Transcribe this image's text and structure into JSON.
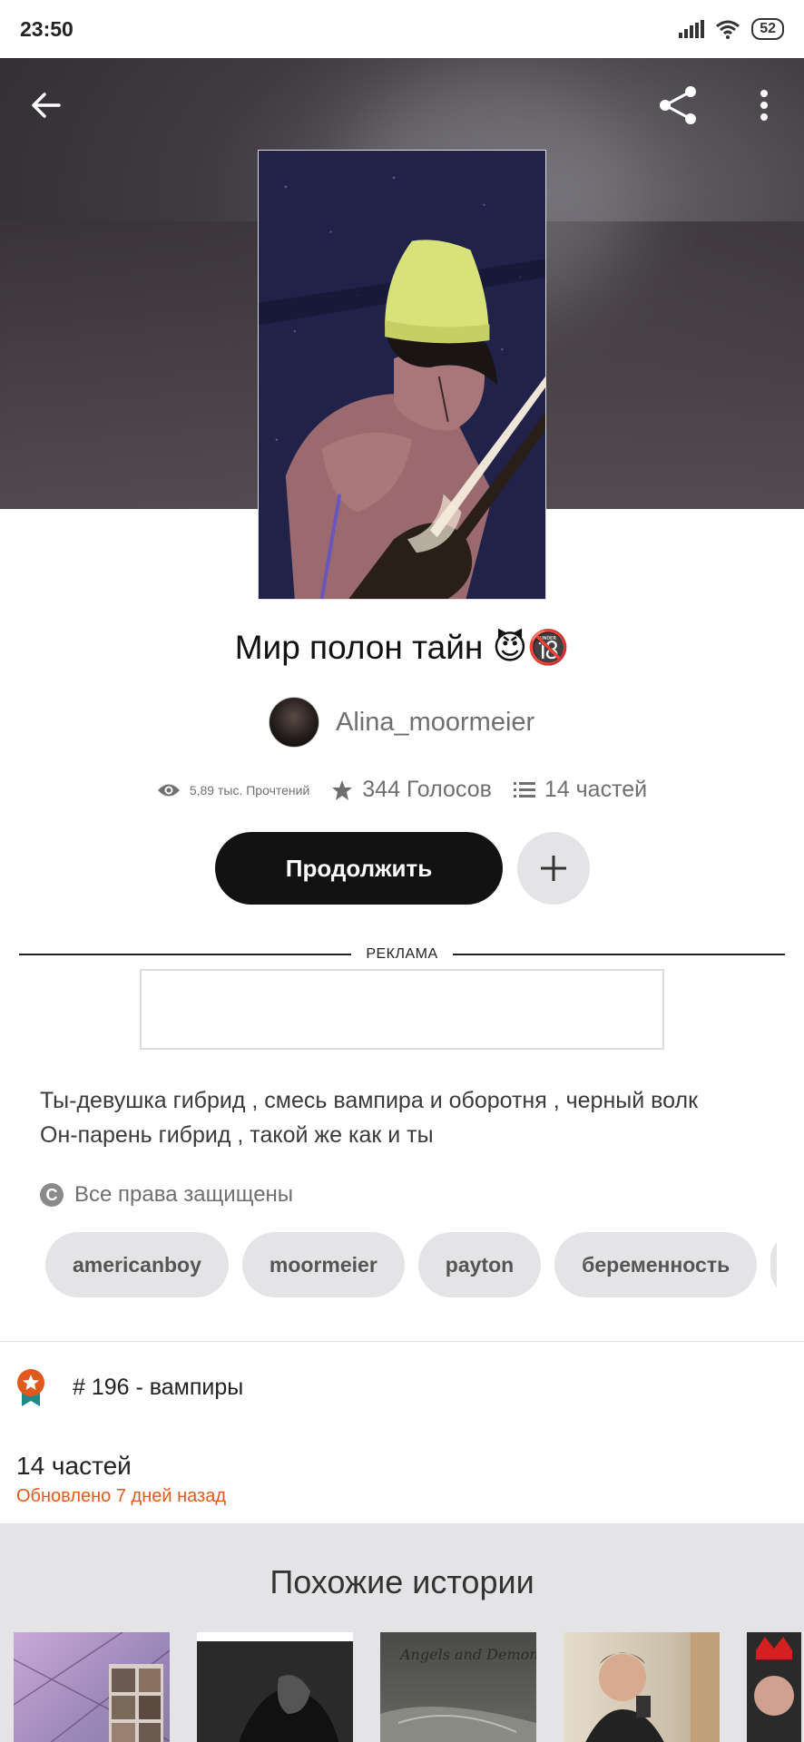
{
  "status_bar": {
    "time": "23:50",
    "battery": "52"
  },
  "story": {
    "title": "Мир полон тайн 😈🔞",
    "author": "Alina_moormeier",
    "reads": "5,89 тыс. Прочтений",
    "votes": "344 Голосов",
    "parts": "14 частей"
  },
  "actions": {
    "continue_label": "Продолжить"
  },
  "ad": {
    "label": "РЕКЛАМА"
  },
  "description": {
    "line1": "Ты-девушка гибрид , смесь вампира и оборотня , черный волк",
    "line2": "Он-парень гибрид , такой же как и ты"
  },
  "copyright": "Все права защищены",
  "tags": [
    "americanboy",
    "moormeier",
    "payton",
    "беременность"
  ],
  "ranking": "# 196 - вампиры",
  "parts_section": {
    "title": "14 частей",
    "updated": "Обновлено 7 дней назад"
  },
  "similar": {
    "title": "Похожие истории",
    "cover_texts": [
      "Angels and Demons"
    ]
  },
  "colors": {
    "accent": "#e05a1d",
    "button_dark": "#121212",
    "panel_gray": "#e4e3e5"
  }
}
